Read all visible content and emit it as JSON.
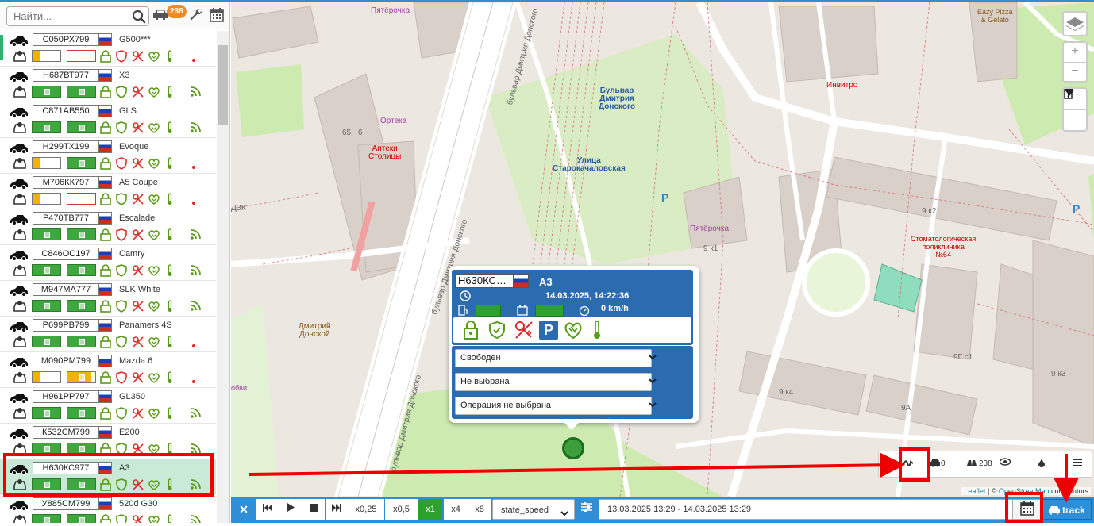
{
  "search": {
    "placeholder": "Найти..."
  },
  "vehicle_count": "238",
  "vehicles": [
    {
      "plate": "С050РХ799",
      "model": "G500***",
      "state": "partial"
    },
    {
      "plate": "Н687ВТ977",
      "model": "X3",
      "state": "ok"
    },
    {
      "plate": "С871АВ550",
      "model": "GLS",
      "state": "ok"
    },
    {
      "plate": "Н299ТХ199",
      "model": "Evoque",
      "state": "partial"
    },
    {
      "plate": "М706КК797",
      "model": "A5 Coupe",
      "state": "partial"
    },
    {
      "plate": "Р470ТВ777",
      "model": "Escalade",
      "state": "ok"
    },
    {
      "plate": "С846ОС197",
      "model": "Camry",
      "state": "ok"
    },
    {
      "plate": "М947МА777",
      "model": "SLK White",
      "state": "ok"
    },
    {
      "plate": "Р699РВ799",
      "model": "Panamers 4S",
      "state": "ok"
    },
    {
      "plate": "М090РМ799",
      "model": "Mazda 6",
      "state": "partial"
    },
    {
      "plate": "Н961РР797",
      "model": "GL350",
      "state": "ok"
    },
    {
      "plate": "К532СМ799",
      "model": "E200",
      "state": "ok"
    },
    {
      "plate": "Н630КС977",
      "model": "A3",
      "state": "ok"
    },
    {
      "plate": "У885СМ799",
      "model": "520d G30",
      "state": "ok"
    }
  ],
  "map_labels": {
    "pyaterochka1": "Пятёрочка",
    "eazy": "Eazy Pizza\n& Gelato",
    "invitro": "Инвитро",
    "ortека": "Ортека",
    "apteki": "Аптеки\nСтолицы",
    "bulvar_metro": "Бульвар\nДмитрия\nДонского",
    "starokach": "Улица\nСтарокачаловская",
    "pyaterochka2": "Пятёрочка",
    "stomat": "Стоматологическая\nполиклиника\n№64",
    "dmitry": "Дмитрий\nДонской",
    "street1": "бульвар Дмитрия Донского",
    "street2": "бульвар Дмитрия Донского",
    "street3": "бульвар Дмитрия Донского",
    "dzk": "ДЗК",
    "h65": "65",
    "h6": "6",
    "h9k1": "9 к1",
    "h9k2": "9 к2",
    "h9k4": "9 к4",
    "h9a": "9А",
    "h9gs1": "9Г с1",
    "h9k3": "9 к3",
    "parking": "P",
    "obi": "обви"
  },
  "attribution": {
    "leaflet": "Leaflet",
    "sep": " | © ",
    "osm": "OpenStreetMap",
    "tail": " contributors"
  },
  "map_toolbar": {
    "count_a": "0",
    "count_b": "238"
  },
  "popup": {
    "plate": "Н630КС…",
    "model": "A3",
    "datetime": "14.03.2025, 14:22:36",
    "speed": "0 km/h",
    "status_select": "Свободен",
    "driver_select": "Не выбрана",
    "operation_select": "Операция не выбрана"
  },
  "playback": {
    "speeds": [
      "x0,25",
      "x0,5",
      "x1",
      "x4",
      "x8"
    ],
    "active_speed": "x1",
    "param_select": "state_speed",
    "date_range": "13.03.2025 13:29 - 14.03.2025 13:29",
    "track_label": "track"
  },
  "colors": {
    "accent": "#2f8fd6",
    "ok": "#3ea83e",
    "alert": "#e00000",
    "warn": "#f0b400",
    "popup": "#2b6cb0"
  }
}
